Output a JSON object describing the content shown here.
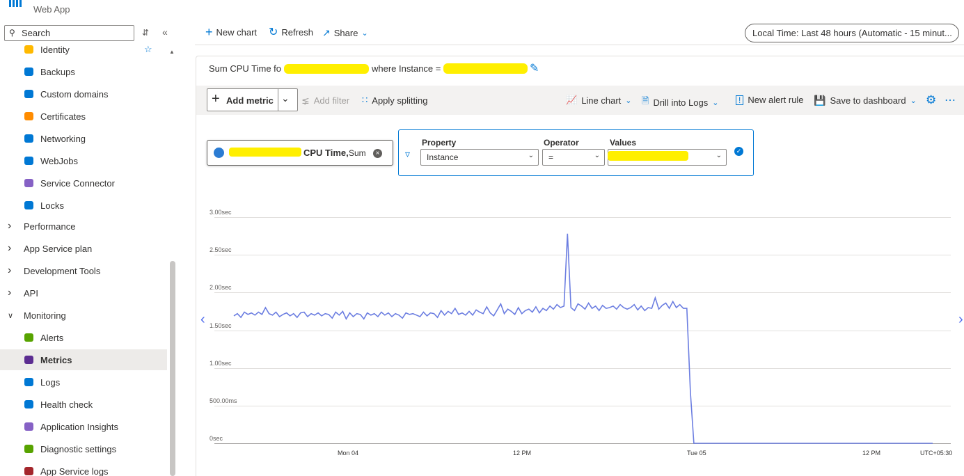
{
  "app": {
    "subtitle": "Web App"
  },
  "sidebar": {
    "search_placeholder": "Search",
    "items": [
      {
        "label": "Identity",
        "icon": "identity-icon",
        "type": "item"
      },
      {
        "label": "Backups",
        "icon": "backups-icon",
        "type": "item"
      },
      {
        "label": "Custom domains",
        "icon": "custom-domains-icon",
        "type": "item"
      },
      {
        "label": "Certificates",
        "icon": "certificates-icon",
        "type": "item"
      },
      {
        "label": "Networking",
        "icon": "networking-icon",
        "type": "item"
      },
      {
        "label": "WebJobs",
        "icon": "webjobs-icon",
        "type": "item"
      },
      {
        "label": "Service Connector",
        "icon": "service-connector-icon",
        "type": "item"
      },
      {
        "label": "Locks",
        "icon": "lock-icon",
        "type": "item"
      },
      {
        "label": "Performance",
        "type": "group",
        "expanded": false
      },
      {
        "label": "App Service plan",
        "type": "group",
        "expanded": false
      },
      {
        "label": "Development Tools",
        "type": "group",
        "expanded": false
      },
      {
        "label": "API",
        "type": "group",
        "expanded": false
      },
      {
        "label": "Monitoring",
        "type": "group",
        "expanded": true
      },
      {
        "label": "Alerts",
        "icon": "alerts-icon",
        "type": "item"
      },
      {
        "label": "Metrics",
        "icon": "metrics-icon",
        "type": "item",
        "selected": true
      },
      {
        "label": "Logs",
        "icon": "logs-icon",
        "type": "item"
      },
      {
        "label": "Health check",
        "icon": "health-check-icon",
        "type": "item"
      },
      {
        "label": "Application Insights",
        "icon": "application-insights-icon",
        "type": "item"
      },
      {
        "label": "Diagnostic settings",
        "icon": "diagnostic-settings-icon",
        "type": "item"
      },
      {
        "label": "App Service logs",
        "icon": "app-service-logs-icon",
        "type": "item"
      }
    ]
  },
  "toolbar": {
    "new_chart": "New chart",
    "refresh": "Refresh",
    "share": "Share",
    "time_range": "Local Time: Last 48 hours (Automatic - 15 minut..."
  },
  "chart_panel": {
    "title_prefix": "Sum CPU Time fo",
    "title_middle": "where Instance =",
    "add_metric": "Add metric",
    "add_filter": "Add filter",
    "apply_splitting": "Apply splitting",
    "line_chart": "Line chart",
    "drill_logs": "Drill into Logs",
    "new_alert": "New alert rule",
    "save_dashboard": "Save to dashboard",
    "metric_pill": {
      "metric": "CPU Time,",
      "aggregation": "Sum"
    },
    "filter": {
      "property_label": "Property",
      "property_value": "Instance",
      "operator_label": "Operator",
      "operator_value": "=",
      "values_label": "Values"
    }
  },
  "colors": {
    "accent": "#0078d4",
    "series": "#6c7ee1",
    "redaction": "#ffef00"
  },
  "chart_data": {
    "type": "line",
    "y_ticks": [
      "3.00sec",
      "2.50sec",
      "2.00sec",
      "1.50sec",
      "1.00sec",
      "500.00ms",
      "0sec"
    ],
    "x_ticks": [
      "Mon 04",
      "12 PM",
      "Tue 05",
      "12 PM"
    ],
    "timezone": "UTC+05:30",
    "ylim": [
      0,
      3.0
    ],
    "y_unit": "sec",
    "grid": true,
    "series": [
      {
        "values": [
          1.69,
          1.72,
          1.67,
          1.74,
          1.71,
          1.73,
          1.7,
          1.74,
          1.71,
          1.8,
          1.72,
          1.7,
          1.74,
          1.68,
          1.71,
          1.73,
          1.69,
          1.72,
          1.67,
          1.73,
          1.74,
          1.68,
          1.72,
          1.7,
          1.73,
          1.69,
          1.72,
          1.71,
          1.66,
          1.74,
          1.7,
          1.75,
          1.65,
          1.73,
          1.68,
          1.72,
          1.71,
          1.65,
          1.73,
          1.7,
          1.72,
          1.68,
          1.74,
          1.7,
          1.73,
          1.68,
          1.72,
          1.7,
          1.66,
          1.73,
          1.71,
          1.72,
          1.7,
          1.68,
          1.74,
          1.69,
          1.73,
          1.72,
          1.67,
          1.76,
          1.7,
          1.75,
          1.72,
          1.79,
          1.71,
          1.73,
          1.7,
          1.75,
          1.7,
          1.77,
          1.74,
          1.72,
          1.81,
          1.73,
          1.69,
          1.77,
          1.85,
          1.72,
          1.78,
          1.75,
          1.71,
          1.8,
          1.72,
          1.76,
          1.78,
          1.74,
          1.81,
          1.73,
          1.79,
          1.76,
          1.82,
          1.78,
          1.84,
          1.8,
          1.82,
          2.78,
          1.8,
          1.76,
          1.85,
          1.82,
          1.78,
          1.86,
          1.79,
          1.82,
          1.76,
          1.83,
          1.79,
          1.8,
          1.82,
          1.78,
          1.84,
          1.8,
          1.78,
          1.8,
          1.84,
          1.77,
          1.82,
          1.76,
          1.8,
          1.79,
          1.93,
          1.78,
          1.83,
          1.86,
          1.79,
          1.88,
          1.8,
          1.84,
          1.79,
          1.79,
          0.68,
          0.0,
          0.0,
          0.0,
          0.0,
          0.0,
          0.0,
          0.0,
          0.0,
          0.0,
          0.0,
          0.0,
          0.0,
          0.0,
          0.0,
          0.0,
          0.0,
          0.0,
          0.0,
          0.0,
          0.0,
          0.0,
          0.0,
          0.0,
          0.0,
          0.0,
          0.0,
          0.0,
          0.0,
          0.0,
          0.0,
          0.0,
          0.0,
          0.0,
          0.0,
          0.0,
          0.0,
          0.0,
          0.0,
          0.0,
          0.0,
          0.0,
          0.0,
          0.0,
          0.0,
          0.0,
          0.0,
          0.0,
          0.0,
          0.0,
          0.0,
          0.0,
          0.0,
          0.0,
          0.0,
          0.0,
          0.0,
          0.0,
          0.0,
          0.0,
          0.0,
          0.0,
          0.0,
          0.0,
          0.0,
          0.0,
          0.0,
          0.0,
          0.0,
          0.0
        ]
      }
    ]
  }
}
